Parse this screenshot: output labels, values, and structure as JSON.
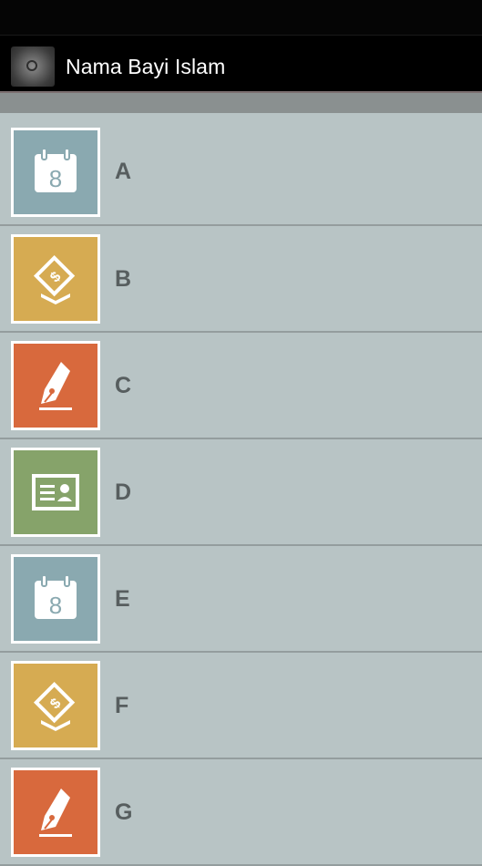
{
  "app": {
    "title": "Nama Bayi Islam",
    "icon": "app-logo-icon"
  },
  "colors": {
    "calendar": "#8aa9b0",
    "certificate": "#d6ab52",
    "pen": "#d8693d",
    "idcard": "#86a36a"
  },
  "items": [
    {
      "letter": "A",
      "icon": "calendar-icon",
      "color": "#8aa9b0"
    },
    {
      "letter": "B",
      "icon": "certificate-icon",
      "color": "#d6ab52"
    },
    {
      "letter": "C",
      "icon": "pen-nib-icon",
      "color": "#d8693d"
    },
    {
      "letter": "D",
      "icon": "id-card-icon",
      "color": "#86a36a"
    },
    {
      "letter": "E",
      "icon": "calendar-icon",
      "color": "#8aa9b0"
    },
    {
      "letter": "F",
      "icon": "certificate-icon",
      "color": "#d6ab52"
    },
    {
      "letter": "G",
      "icon": "pen-nib-icon",
      "color": "#d8693d"
    }
  ]
}
